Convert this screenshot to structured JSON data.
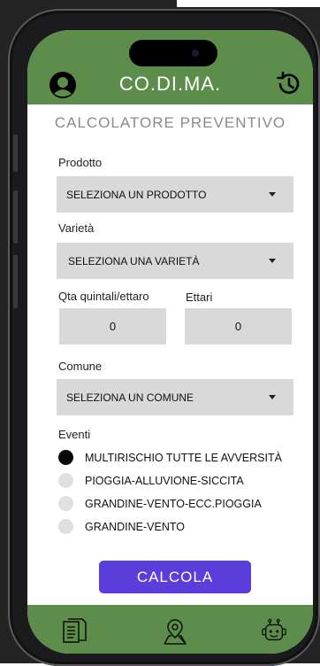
{
  "app": {
    "title": "CO.DI.MA."
  },
  "header": {
    "user_icon": "user-icon",
    "history_icon": "history-icon"
  },
  "form": {
    "title": "CALCOLATORE PREVENTIVO",
    "prodotto": {
      "label": "Prodotto",
      "value": "SELEZIONA UN PRODOTTO"
    },
    "varieta": {
      "label": "Varietà",
      "value": "SELEZIONA UNA VARIETÀ"
    },
    "qta": {
      "label": "Qta quintali/ettaro",
      "value": "0"
    },
    "ettari": {
      "label": "Ettari",
      "value": "0"
    },
    "comune": {
      "label": "Comune",
      "value": "SELEZIONA UN COMUNE"
    },
    "eventi": {
      "label": "Eventi",
      "options": [
        {
          "label": "MULTIRISCHIO TUTTE LE AVVERSITÀ",
          "selected": true
        },
        {
          "label": "PIOGGIA-ALLUVIONE-SICCITA",
          "selected": false
        },
        {
          "label": "GRANDINE-VENTO-ECC.PIOGGIA",
          "selected": false
        },
        {
          "label": "GRANDINE-VENTO",
          "selected": false
        }
      ]
    },
    "submit_label": "CALCOLA"
  },
  "bottom_nav": {
    "items": [
      {
        "icon": "document-icon"
      },
      {
        "icon": "map-pin-icon"
      },
      {
        "icon": "robot-icon"
      }
    ]
  },
  "colors": {
    "header": "#5c8d4b",
    "button": "#5b3ddb",
    "field": "#d9d9d9"
  }
}
